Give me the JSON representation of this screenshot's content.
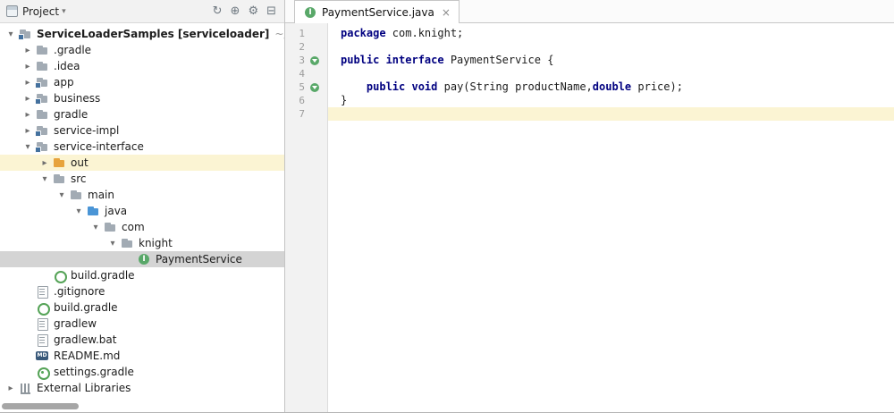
{
  "project_panel": {
    "header": {
      "title": "Project",
      "caret": "▾",
      "toolbar": [
        {
          "name": "sync-icon",
          "glyph": "↻"
        },
        {
          "name": "locate-file-icon",
          "glyph": "⊕"
        },
        {
          "name": "settings-gear-icon",
          "glyph": "⚙"
        },
        {
          "name": "collapse-all-icon",
          "glyph": "⊟"
        }
      ]
    },
    "tree": [
      {
        "label": "ServiceLoaderSamples [serviceloader]",
        "qualifier": "~/code",
        "level": 0,
        "state": "expanded",
        "icon": "module",
        "bold": true
      },
      {
        "label": ".gradle",
        "level": 1,
        "state": "collapsed",
        "icon": "folder"
      },
      {
        "label": ".idea",
        "level": 1,
        "state": "collapsed",
        "icon": "folder"
      },
      {
        "label": "app",
        "level": 1,
        "state": "collapsed",
        "icon": "module"
      },
      {
        "label": "business",
        "level": 1,
        "state": "collapsed",
        "icon": "module"
      },
      {
        "label": "gradle",
        "level": 1,
        "state": "collapsed",
        "icon": "folder"
      },
      {
        "label": "service-impl",
        "level": 1,
        "state": "collapsed",
        "icon": "module"
      },
      {
        "label": "service-interface",
        "level": 1,
        "state": "expanded",
        "icon": "module"
      },
      {
        "label": "out",
        "level": 2,
        "state": "collapsed",
        "icon": "folder-excluded",
        "highlight": "open"
      },
      {
        "label": "src",
        "level": 2,
        "state": "expanded",
        "icon": "folder"
      },
      {
        "label": "main",
        "level": 3,
        "state": "expanded",
        "icon": "folder"
      },
      {
        "label": "java",
        "level": 4,
        "state": "expanded",
        "icon": "folder-source"
      },
      {
        "label": "com",
        "level": 5,
        "state": "expanded",
        "icon": "folder"
      },
      {
        "label": "knight",
        "level": 6,
        "state": "expanded",
        "icon": "folder"
      },
      {
        "label": "PaymentService",
        "level": 7,
        "state": "leaf",
        "icon": "interface",
        "highlight": "selected"
      },
      {
        "label": "build.gradle",
        "level": 2,
        "state": "leaf",
        "icon": "gradle"
      },
      {
        "label": ".gitignore",
        "level": 1,
        "state": "leaf",
        "icon": "file"
      },
      {
        "label": "build.gradle",
        "level": 1,
        "state": "leaf",
        "icon": "gradle"
      },
      {
        "label": "gradlew",
        "level": 1,
        "state": "leaf",
        "icon": "file"
      },
      {
        "label": "gradlew.bat",
        "level": 1,
        "state": "leaf",
        "icon": "file"
      },
      {
        "label": "README.md",
        "level": 1,
        "state": "leaf",
        "icon": "markdown"
      },
      {
        "label": "settings.gradle",
        "level": 1,
        "state": "leaf",
        "icon": "gradle-settings"
      },
      {
        "label": "External Libraries",
        "level": 0,
        "state": "collapsed",
        "icon": "libraries"
      }
    ]
  },
  "editor": {
    "tab": {
      "title": "PaymentService.java",
      "icon": "interface",
      "close": "×"
    },
    "code_lines": [
      {
        "num": "1",
        "segments": [
          {
            "text": "package",
            "style": "keyword"
          },
          {
            "text": " com.knight;",
            "style": "plain"
          }
        ]
      },
      {
        "num": "2",
        "segments": []
      },
      {
        "num": "3",
        "marker": "implemented",
        "segments": [
          {
            "text": "public interface",
            "style": "keyword"
          },
          {
            "text": " PaymentService {",
            "style": "plain"
          }
        ]
      },
      {
        "num": "4",
        "segments": []
      },
      {
        "num": "5",
        "marker": "implemented",
        "segments": [
          {
            "text": "    ",
            "style": "plain"
          },
          {
            "text": "public void",
            "style": "keyword"
          },
          {
            "text": " pay(String productName,",
            "style": "plain"
          },
          {
            "text": "double",
            "style": "keyword"
          },
          {
            "text": " price);",
            "style": "plain"
          }
        ]
      },
      {
        "num": "6",
        "segments": [
          {
            "text": "}",
            "style": "plain"
          }
        ]
      },
      {
        "num": "7",
        "current": true,
        "segments": []
      }
    ]
  },
  "colors": {
    "keyword": "#000080",
    "selection_row": "#d4d4d4",
    "open_file_row": "#fbf4d3",
    "current_line": "#fbf4d3",
    "interface_icon_green": "#59a869",
    "source_folder_blue": "#4a95d6",
    "excluded_folder_orange": "#e7a33c"
  }
}
